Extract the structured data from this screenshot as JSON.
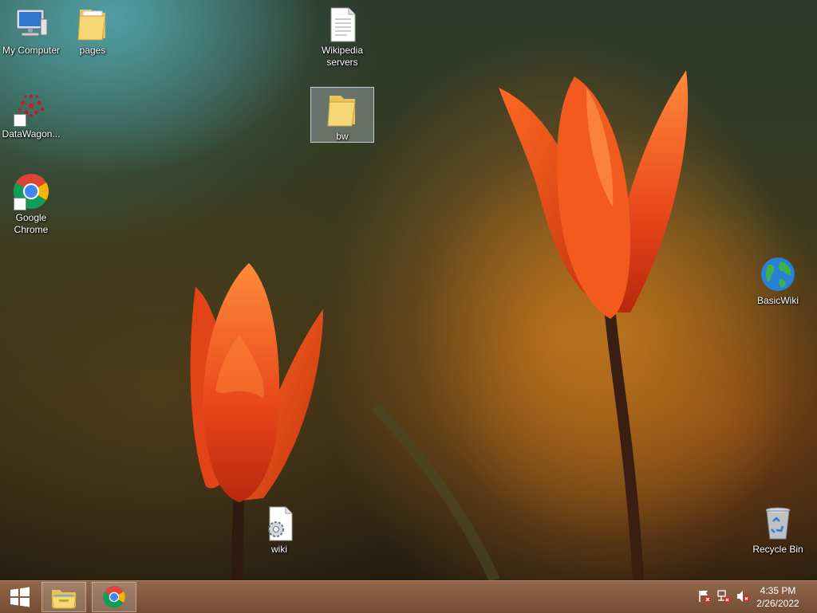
{
  "desktop_icons": [
    {
      "id": "my-computer",
      "label": "My Computer"
    },
    {
      "id": "pages",
      "label": "pages"
    },
    {
      "id": "wikipedia-servers",
      "label": "Wikipedia servers"
    },
    {
      "id": "datawagon",
      "label": "DataWagon..."
    },
    {
      "id": "bw",
      "label": "bw"
    },
    {
      "id": "google-chrome",
      "label": "Google Chrome"
    },
    {
      "id": "basicwiki",
      "label": "BasicWiki"
    },
    {
      "id": "wiki",
      "label": "wiki"
    },
    {
      "id": "recycle-bin",
      "label": "Recycle Bin"
    }
  ],
  "taskbar": {
    "start_icon": "windows-logo-icon",
    "pinned": [
      {
        "id": "file-explorer",
        "icon": "file-explorer-icon"
      },
      {
        "id": "chrome",
        "icon": "chrome-icon"
      }
    ],
    "tray": [
      "flag-alert-icon",
      "network-icon",
      "speaker-muted-icon"
    ],
    "clock": {
      "time": "4:35 PM",
      "date": "2/26/2022"
    }
  },
  "colors": {
    "tulip": "#e8461a",
    "tulip_highlight": "#ff7a2a",
    "stem": "#3b1e12",
    "taskbar": "#8a5a40"
  }
}
